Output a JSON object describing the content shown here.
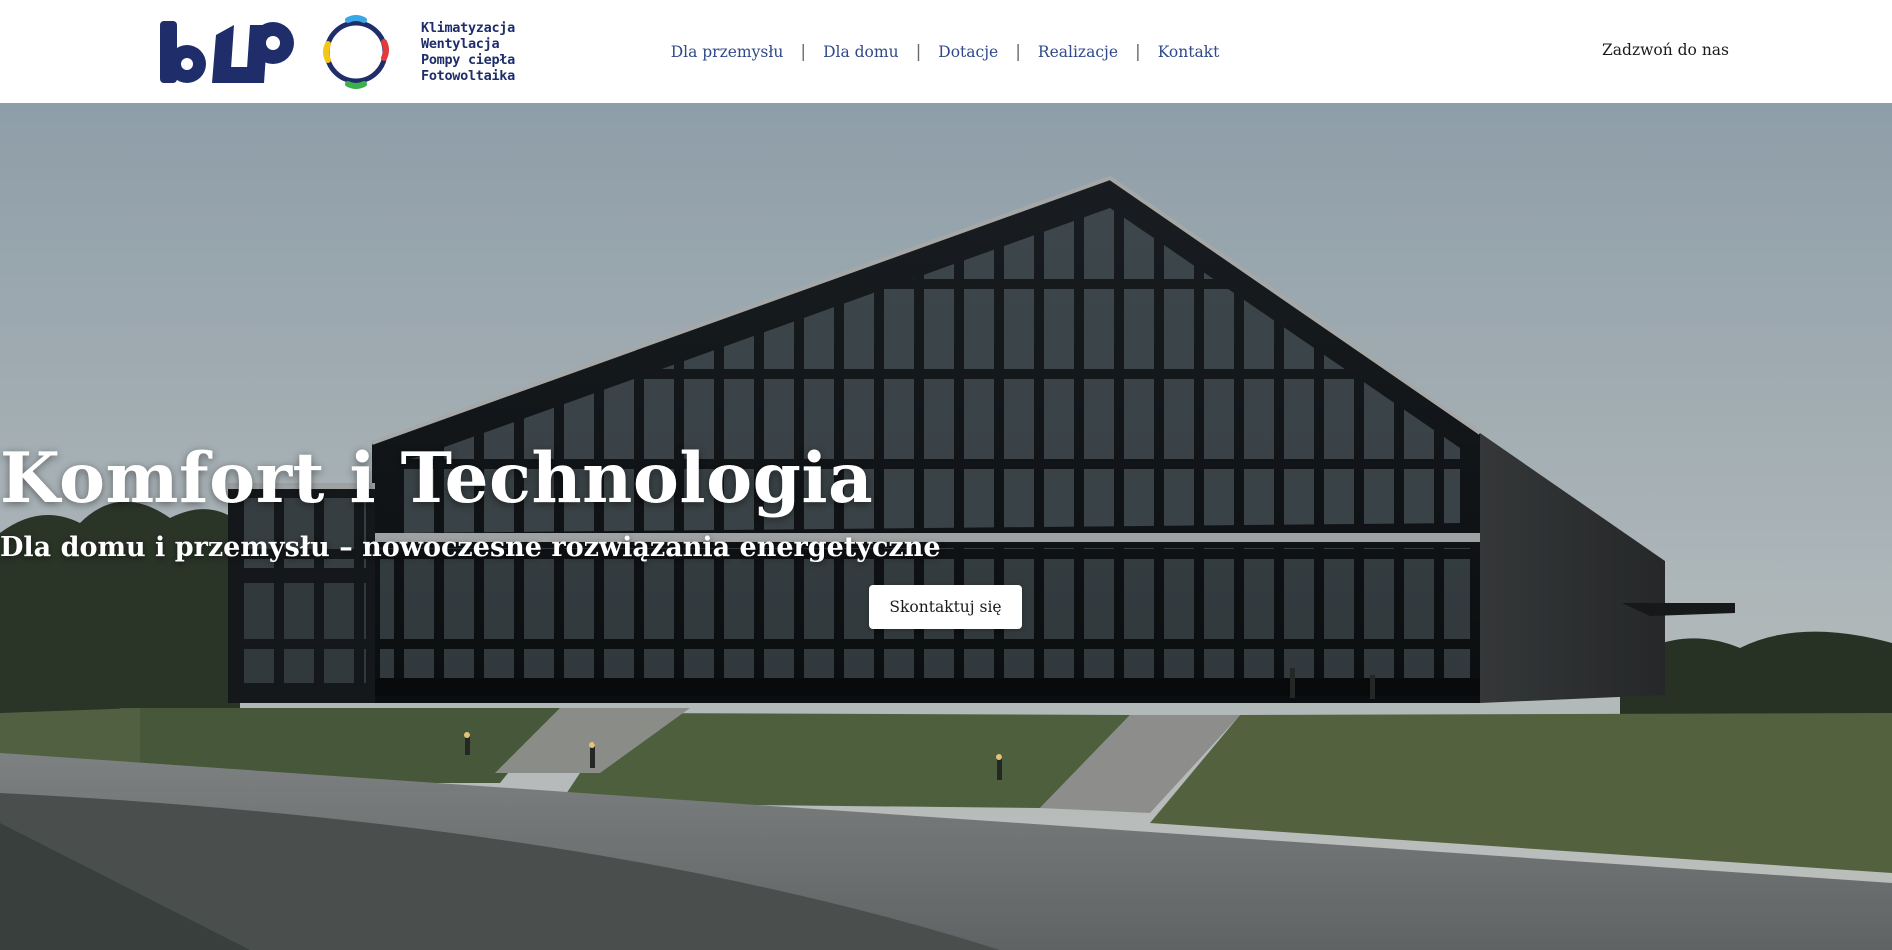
{
  "brand": {
    "logo_icon": "blp-logo",
    "ring_icon": "ring-logo-icon",
    "tagline": [
      "Klimatyzacja",
      "Wentylacja",
      "Pompy ciepła",
      "Fotowoltaika"
    ],
    "primary_color": "#1f2e6b"
  },
  "nav": {
    "items": [
      {
        "label": "Dla przemysłu"
      },
      {
        "label": "Dla domu"
      },
      {
        "label": "Dotacje"
      },
      {
        "label": "Realizacje"
      },
      {
        "label": "Kontakt"
      }
    ],
    "separator": "|",
    "link_color": "#2f4a8a"
  },
  "header": {
    "call_label": "Zadzwoń do nas"
  },
  "hero": {
    "title": "Komfort i Technologia",
    "subtitle": "Dla domu i przemysłu – nowoczesne rozwiązania energetyczne",
    "cta_label": "Skontaktuj się",
    "background": "modern-glass-building-photo"
  }
}
